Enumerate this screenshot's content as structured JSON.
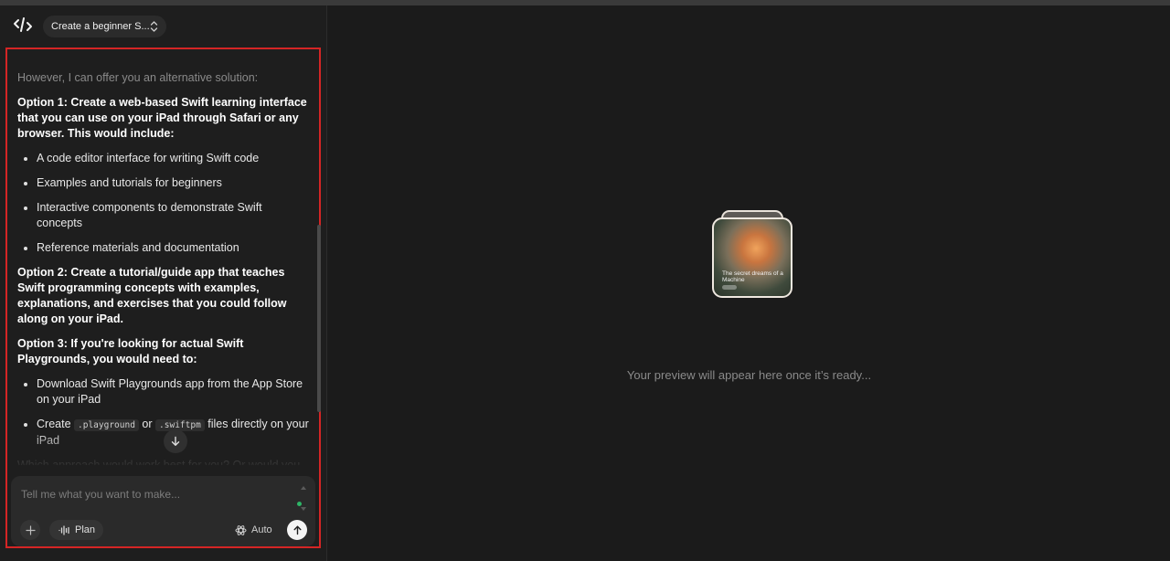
{
  "header": {
    "project_name": "Create a beginner S..."
  },
  "chat": {
    "intro": "However, I can offer you an alternative solution:",
    "option1": "Option 1: Create a web-based Swift learning interface that you can use on your iPad through Safari or any browser. This would include:",
    "option1_items": [
      "A code editor interface for writing Swift code",
      "Examples and tutorials for beginners",
      "Interactive components to demonstrate Swift concepts",
      "Reference materials and documentation"
    ],
    "option2": "Option 2: Create a tutorial/guide app that teaches Swift programming concepts with examples, explanations, and exercises that you could follow along on your iPad.",
    "option3": "Option 3: If you're looking for actual Swift Playgrounds, you would need to:",
    "option3_item1": "Download Swift Playgrounds app from the App Store on your iPad",
    "option3_item2": {
      "prefix": "Create",
      "code1": ".playground",
      "middle": "or",
      "code2": ".swiftpm",
      "suffix": "files directly on your iPad"
    },
    "closing": "Which approach would work best for you? Or would you like something different?"
  },
  "composer": {
    "placeholder": "Tell me what you want to make...",
    "plan_label": "Plan",
    "auto_label": "Auto"
  },
  "preview": {
    "thumbnail_caption": "The secret dreams of a Machine",
    "message": "Your preview will appear here once it’s ready..."
  },
  "colors": {
    "highlight_border": "#d42525",
    "status_dot": "#2eb567"
  },
  "icons": {
    "logo": "code-brackets-icon",
    "project_chevron": "chevron-updown-icon",
    "scroll_down": "arrow-down-icon",
    "plus": "plus-icon",
    "plan": "waveform-icon",
    "auto": "atom-icon",
    "send": "arrow-up-icon"
  }
}
